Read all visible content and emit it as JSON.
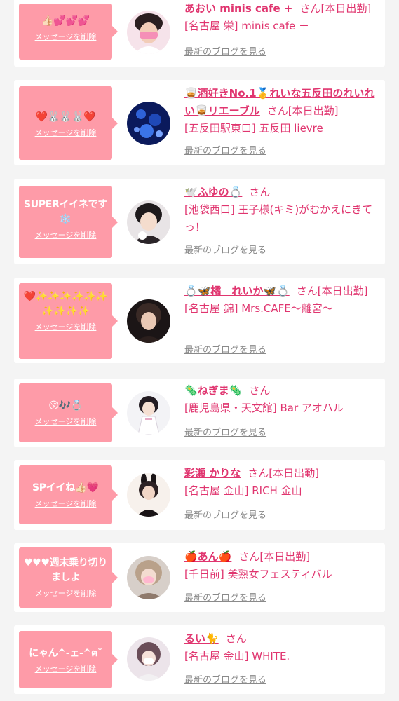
{
  "delete_label": "メッセージを削除",
  "blog_label": "最新のブログを見る",
  "accent_color": "#e0356f",
  "bubble_color": "#fe9ba8",
  "entries": [
    {
      "message": "👍🏻💕💕💕",
      "name": "あおい minis cafe +",
      "suffix": "さん[本日出勤]",
      "shop": "[名古屋 栄] minis cafe ＋",
      "avatar_icon": "girl-portrait-photo"
    },
    {
      "message": "❤️🐰🐰🐰❤️",
      "name": "🥃酒好きNo.1🥇れいな五反田のれいれい🥃リエーブル",
      "suffix": "さん[本日出勤]",
      "shop": "[五反田駅東口] 五反田 lievre",
      "avatar_icon": "blue-lights-photo"
    },
    {
      "message": "SUPERイイネです❄️",
      "name": "🕊️ふゆの💍",
      "suffix": "さん",
      "shop": "[池袋西口] 王子様(キミ)がむかえにきてっ！",
      "avatar_icon": "girl-portrait-photo"
    },
    {
      "message": "❤️✨✨✨✨✨✨✨✨✨✨",
      "name": "💍🦋橘　れいか🦋💍",
      "suffix": "さん[本日出勤]",
      "shop": "[名古屋 錦] Mrs.CAFE〜離宮〜",
      "avatar_icon": "girl-portrait-photo"
    },
    {
      "message": "😚🎶💍",
      "name": "🦠ねぎま🦠",
      "suffix": "さん",
      "shop": "[鹿児島県・天文館] Bar アオハル",
      "avatar_icon": "girl-portrait-photo"
    },
    {
      "message": "SPイイね👍🏻💗",
      "name": "彩瀬 かりな",
      "suffix": "さん[本日出勤]",
      "shop": "[名古屋 金山] RICH 金山",
      "avatar_icon": "girl-portrait-photo"
    },
    {
      "message": "♥♥♥週末乗り切りましよ",
      "name": "🍎あん🍎",
      "suffix": "さん[本日出勤]",
      "shop": "[千日前] 美熟女フェスティバル",
      "avatar_icon": "girl-portrait-photo"
    },
    {
      "message": "にゃん^-ェ-^ฅ˘",
      "name": "るい🐈",
      "suffix": "さん",
      "shop": "[名古屋 金山] WHITE.",
      "avatar_icon": "girl-portrait-photo"
    }
  ]
}
